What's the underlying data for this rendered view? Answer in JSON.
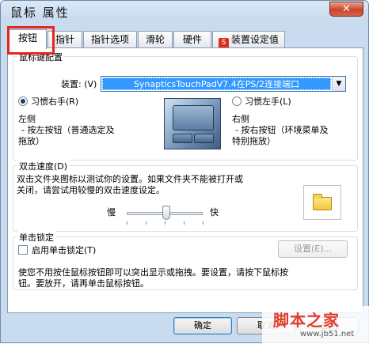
{
  "window": {
    "title": "鼠标 属性",
    "close_glyph": "✕"
  },
  "tabs": [
    {
      "label": "按钮",
      "active": true
    },
    {
      "label": "指针"
    },
    {
      "label": "指针选项"
    },
    {
      "label": "滑轮"
    },
    {
      "label": "硬件"
    },
    {
      "label": "装置设定值",
      "icon": "synaptics-icon",
      "icon_glyph": "S"
    }
  ],
  "button_config": {
    "title": "鼠标键配置",
    "device_label": "装置: (V)",
    "device_value": "SynapticsTouchPadV7.4在PS/2连接端口",
    "right_hand_label": "习惯右手(R)",
    "right_hand_selected": true,
    "left_hand_label": "习惯左手(L)",
    "left_hand_selected": false,
    "left_side_title": "左侧",
    "left_side_desc_1": "- 按左按钮（普通选定及",
    "left_side_desc_2": "拖放）",
    "right_side_title": "右侧",
    "right_side_desc_1": "- 按右按钮（环境菜单及",
    "right_side_desc_2": "特别拖放）"
  },
  "double_click": {
    "title": "双击速度(D)",
    "desc_1": "双击文件夹图标以测试你的设置。如果文件夹不能被打开或",
    "desc_2": "关闭，请尝试用较慢的双击速度设定。",
    "slow_label": "慢",
    "fast_label": "快",
    "speed_fraction": 0.52,
    "folder_icon": "folder-icon"
  },
  "click_lock": {
    "title": "单击锁定",
    "enable_label": "启用单击锁定(T)",
    "enabled": false,
    "settings_label": "设置(E)...",
    "desc_1": "使您不用按住鼠标按钮即可以突出显示或拖拽。要设置，请按下鼠标按",
    "desc_2": "钮。要放开，请再单击鼠标按钮。"
  },
  "footer": {
    "ok_label": "确定",
    "cancel_label": "取消",
    "apply_label": "应用"
  },
  "watermark": {
    "main": "脚本之家",
    "sub": "www.jb51.net"
  },
  "colors": {
    "selection": "#3399ff",
    "highlight_box": "#e8231c",
    "close_button": "#c8452a"
  }
}
